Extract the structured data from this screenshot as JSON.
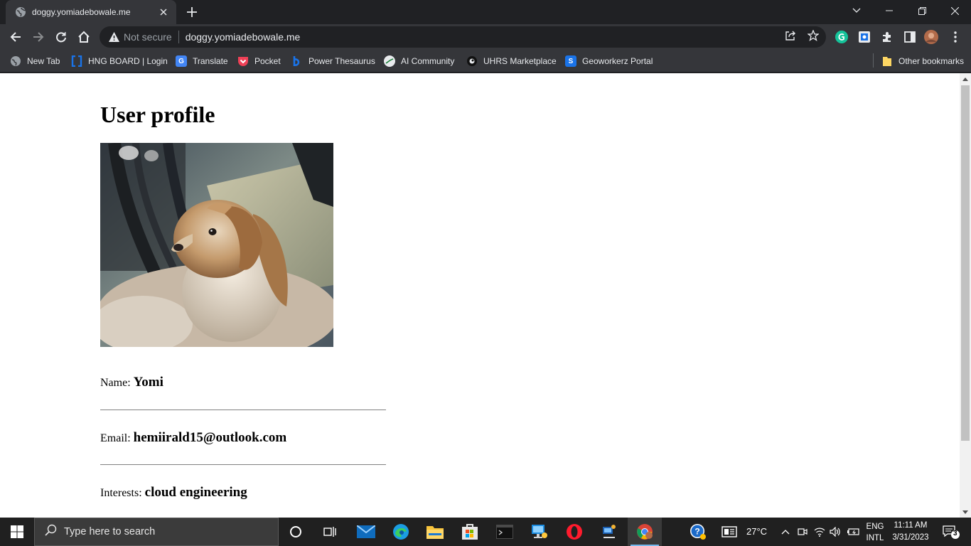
{
  "browser": {
    "tab": {
      "title": "doggy.yomiadebowale.me"
    },
    "address": {
      "security_label": "Not secure",
      "url": "doggy.yomiadebowale.me"
    },
    "bookmarks": [
      {
        "label": "New Tab",
        "icon": "globe-icon",
        "color": "#9aa0a6"
      },
      {
        "label": "HNG BOARD | Login",
        "icon": "bracket-icon",
        "color": "#1a73e8"
      },
      {
        "label": "Translate",
        "icon": "translate-icon",
        "color": "#4285f4"
      },
      {
        "label": "Pocket",
        "icon": "pocket-icon",
        "color": "#ef4056"
      },
      {
        "label": "Power Thesaurus",
        "icon": "thesaurus-icon",
        "color": "#1a73e8"
      },
      {
        "label": "AI Community",
        "icon": "ai-community-icon",
        "color": "#e8eaed"
      },
      {
        "label": "UHRS Marketplace",
        "icon": "uhrs-icon",
        "color": "#202124"
      },
      {
        "label": "Geoworkerz Portal",
        "icon": "geoworkerz-icon",
        "color": "#1a73e8"
      }
    ],
    "other_bookmarks": "Other bookmarks"
  },
  "page": {
    "title": "User profile",
    "photo": {
      "icon": "dog-photo"
    },
    "fields": {
      "name": {
        "label": "Name:",
        "value": "Yomi"
      },
      "email": {
        "label": "Email:",
        "value": "hemiirald15@outlook.com"
      },
      "interests": {
        "label": "Interests:",
        "value": "cloud engineering"
      }
    }
  },
  "taskbar": {
    "search_placeholder": "Type here to search",
    "weather": "27°C",
    "language": {
      "line1": "ENG",
      "line2": "INTL"
    },
    "clock": {
      "time": "11:11 AM",
      "date": "3/31/2023"
    },
    "notifications": "3"
  }
}
